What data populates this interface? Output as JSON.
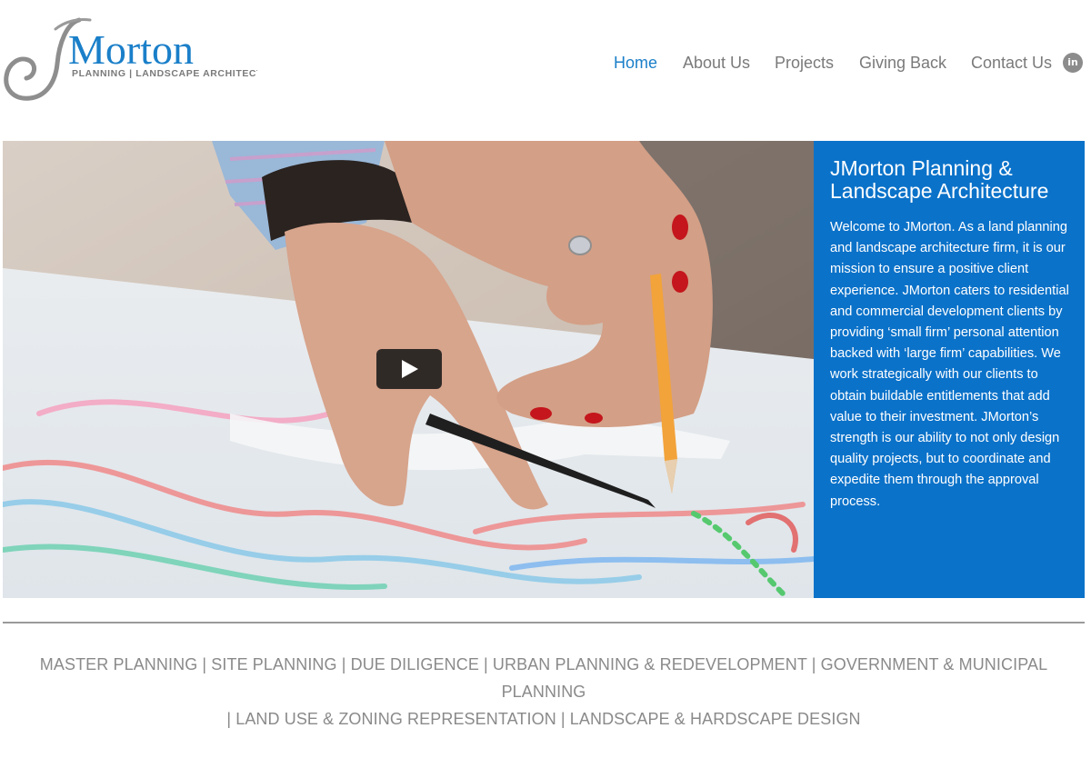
{
  "brand": {
    "logo_text": "Morton",
    "logo_tagline": "PLANNING | LANDSCAPE ARCHITECTURE",
    "logo_initial": "J",
    "color_blue": "#1a7fc9",
    "color_grey": "#7a7a7a"
  },
  "nav": {
    "items": [
      {
        "label": "Home",
        "active": true
      },
      {
        "label": "About Us",
        "active": false
      },
      {
        "label": "Projects",
        "active": false
      },
      {
        "label": "Giving Back",
        "active": false
      },
      {
        "label": "Contact Us",
        "active": false
      }
    ],
    "social": {
      "icon": "linkedin-icon",
      "label": "in"
    }
  },
  "hero": {
    "video_icon": "play-icon",
    "panel_bg": "#0b72c9",
    "title": "JMorton Planning & Landscape Architecture",
    "body": "Welcome to JMorton. As a land planning and landscape architecture firm, it is our mission to ensure a positive client experience. JMorton caters to residential and commercial development clients by providing ‘small firm’ personal attention backed with ‘large firm’ capabilities. We work strategically with our clients to obtain buildable entitlements that add value to their investment. JMorton’s strength is our ability to not only design quality projects, but to coordinate and expedite them through the approval process."
  },
  "services": {
    "line1": "MASTER PLANNING | SITE PLANNING | DUE DILIGENCE | URBAN PLANNING & REDEVELOPMENT | GOVERNMENT & MUNICIPAL PLANNING",
    "line2": "| LAND USE & ZONING REPRESENTATION | LANDSCAPE & HARDSCAPE DESIGN"
  }
}
